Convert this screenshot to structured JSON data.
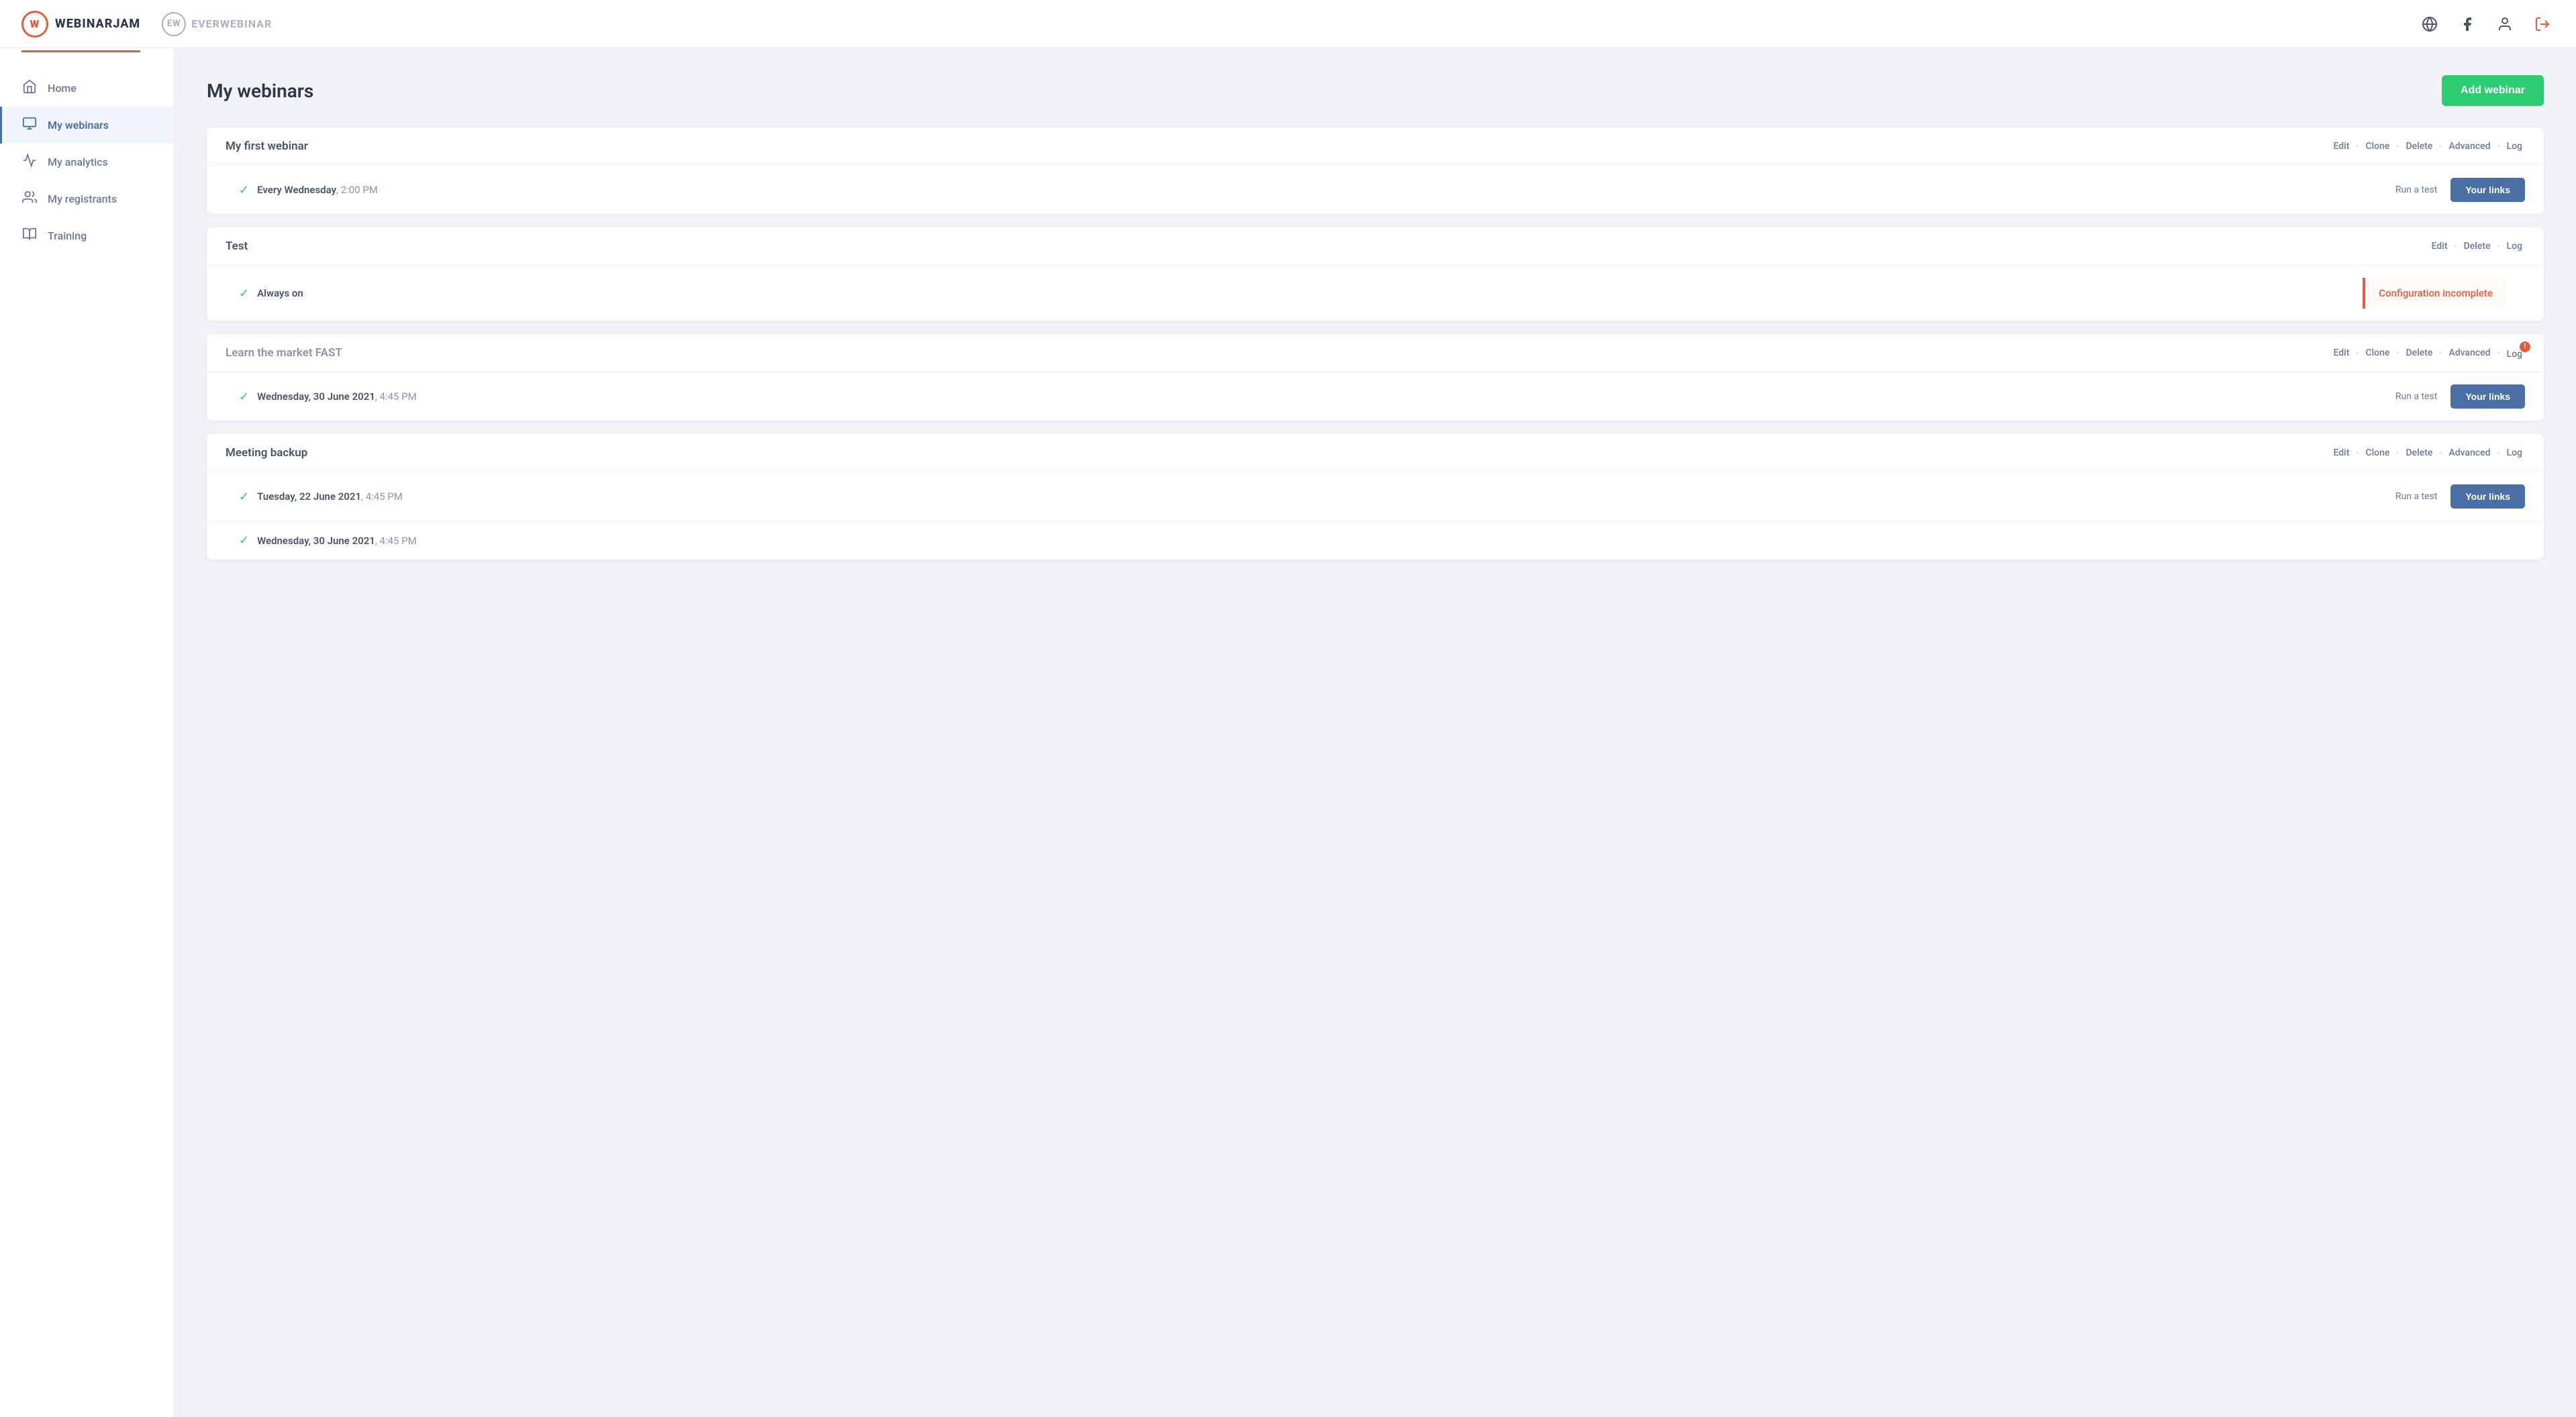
{
  "header": {
    "logo_wj_text": "W",
    "logo_wj_brand": "WEBINARJAM",
    "logo_ew_text": "EW",
    "logo_ew_brand": "EVERWEBINAR",
    "icon_globe": "🌐",
    "icon_facebook": "f",
    "icon_user": "👤",
    "icon_logout": "⏻"
  },
  "sidebar": {
    "items": [
      {
        "id": "home",
        "label": "Home",
        "icon": "🏠",
        "active": false
      },
      {
        "id": "my-webinars",
        "label": "My webinars",
        "icon": "📺",
        "active": true
      },
      {
        "id": "my-analytics",
        "label": "My analytics",
        "icon": "📈",
        "active": false
      },
      {
        "id": "my-registrants",
        "label": "My registrants",
        "icon": "👥",
        "active": false
      },
      {
        "id": "training",
        "label": "Training",
        "icon": "🎓",
        "active": false
      }
    ]
  },
  "main": {
    "page_title": "My webinars",
    "add_webinar_label": "Add webinar",
    "webinars": [
      {
        "id": "wj1",
        "name": "My first webinar",
        "name_muted": false,
        "actions": [
          "Edit",
          "Clone",
          "Delete",
          "Advanced",
          "Log"
        ],
        "has_log_badge": false,
        "sessions": [
          {
            "schedule": "Every Wednesday",
            "time": "2:00 PM",
            "show_run_test": true,
            "run_test_label": "Run a test",
            "your_links_label": "Your links",
            "config_incomplete": false
          }
        ]
      },
      {
        "id": "wj2",
        "name": "Test",
        "name_muted": false,
        "actions": [
          "Edit",
          "Delete",
          "Log"
        ],
        "has_log_badge": false,
        "sessions": [
          {
            "schedule": "Always on",
            "time": "",
            "show_run_test": false,
            "run_test_label": "",
            "your_links_label": "",
            "config_incomplete": true,
            "config_incomplete_label": "Configuration incomplete"
          }
        ]
      },
      {
        "id": "wj3",
        "name": "Learn the market FAST",
        "name_muted": true,
        "actions": [
          "Edit",
          "Clone",
          "Delete",
          "Advanced",
          "Log"
        ],
        "has_log_badge": true,
        "log_badge_count": "!",
        "sessions": [
          {
            "schedule": "Wednesday, 30 June 2021",
            "time": "4:45 PM",
            "show_run_test": true,
            "run_test_label": "Run a test",
            "your_links_label": "Your links",
            "config_incomplete": false
          }
        ]
      },
      {
        "id": "wj4",
        "name": "Meeting backup",
        "name_muted": false,
        "actions": [
          "Edit",
          "Clone",
          "Delete",
          "Advanced",
          "Log"
        ],
        "has_log_badge": false,
        "sessions": [
          {
            "schedule": "Tuesday, 22 June 2021",
            "time": "4:45 PM",
            "show_run_test": true,
            "run_test_label": "Run a test",
            "your_links_label": "Your links",
            "config_incomplete": false
          },
          {
            "schedule": "Wednesday, 30 June 2021",
            "time": "4:45 PM",
            "show_run_test": false,
            "run_test_label": "",
            "your_links_label": "",
            "config_incomplete": false
          }
        ]
      }
    ]
  }
}
